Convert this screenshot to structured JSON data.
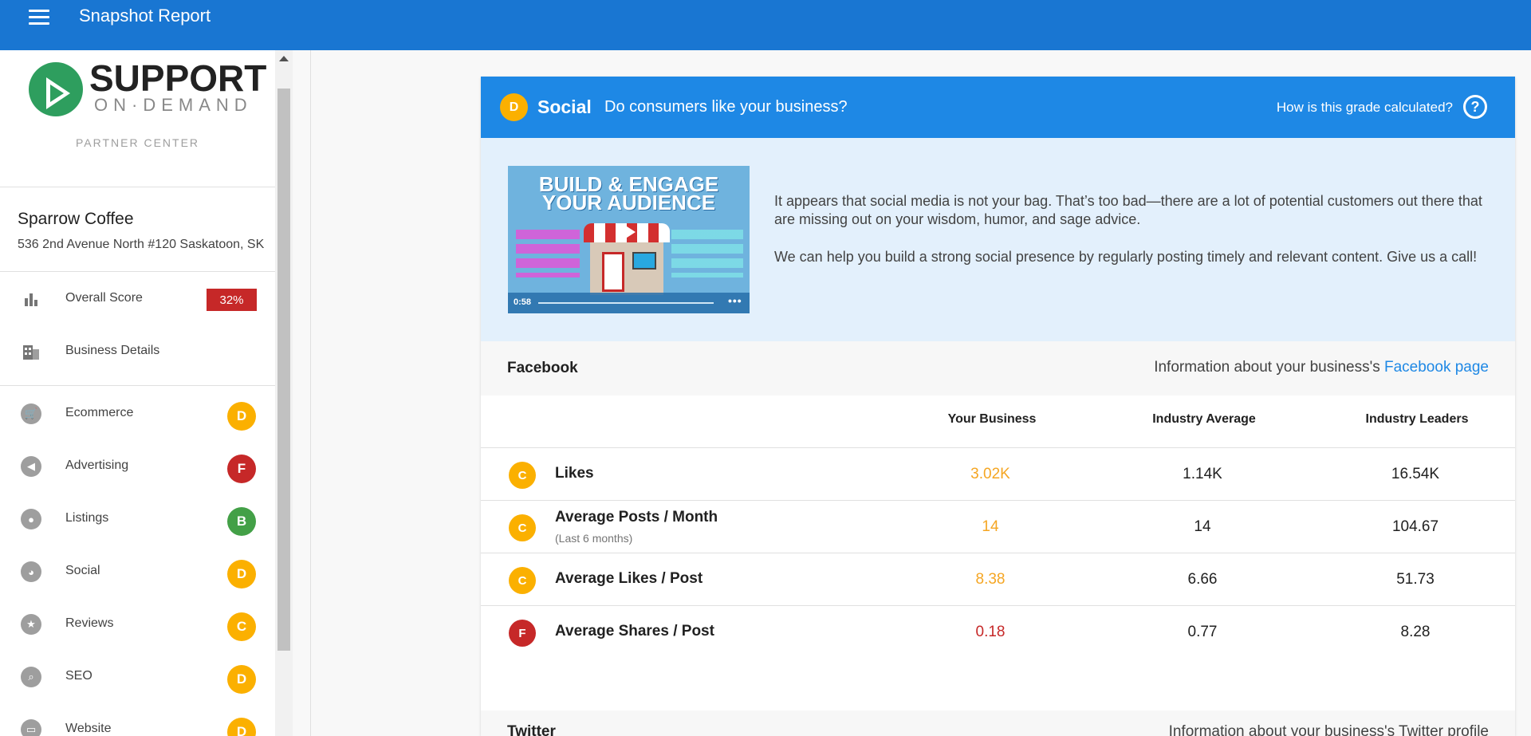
{
  "app": {
    "title": "Snapshot Report"
  },
  "brand": {
    "primary": "#1976d2",
    "panel_blue": "#1e88e5",
    "logo_green": "#2e9e5e"
  },
  "logo": {
    "line1": "SUPPORT",
    "line2": "ON·DEMAND",
    "tagline": "PARTNER CENTER"
  },
  "business": {
    "name": "Sparrow Coffee",
    "address": "536 2nd Avenue North #120 Saskatoon, SK"
  },
  "sidebar": {
    "overall": {
      "label": "Overall Score",
      "score": "32%",
      "icon": "bar-chart-icon"
    },
    "details": {
      "label": "Business Details",
      "icon": "building-icon"
    },
    "items": [
      {
        "label": "Ecommerce",
        "grade": "D",
        "icon": "cart-icon"
      },
      {
        "label": "Advertising",
        "grade": "F",
        "icon": "megaphone-icon"
      },
      {
        "label": "Listings",
        "grade": "B",
        "icon": "pin-icon"
      },
      {
        "label": "Social",
        "grade": "D",
        "icon": "chat-icon"
      },
      {
        "label": "Reviews",
        "grade": "C",
        "icon": "star-icon"
      },
      {
        "label": "SEO",
        "grade": "D",
        "icon": "search-icon"
      },
      {
        "label": "Website",
        "grade": "D",
        "icon": "monitor-icon"
      }
    ]
  },
  "social": {
    "grade": "D",
    "title": "Social",
    "subtitle": "Do consumers like your business?",
    "how_label": "How is this grade calculated?",
    "help_glyph": "?",
    "video": {
      "title_line1": "BUILD & ENGAGE",
      "title_line2": "YOUR AUDIENCE",
      "time": "0:58",
      "more": "•••"
    },
    "paragraph1": " It appears that social media is not your bag. That’s too bad—there are a lot of potential customers out there that are missing out on your wisdom, humor, and sage advice.",
    "paragraph2": "We can help you build a strong social presence by regularly posting timely and relevant content. Give us a call!"
  },
  "facebook": {
    "title": "Facebook",
    "info_prefix": "Information about your business's ",
    "info_link": "Facebook page",
    "columns": [
      "Your Business",
      "Industry Average",
      "Industry Leaders"
    ],
    "rows": [
      {
        "grade": "C",
        "label": "Likes",
        "sub": "",
        "yours": "3.02K",
        "avg": "1.14K",
        "leaders": "16.54K"
      },
      {
        "grade": "C",
        "label": "Average Posts / Month",
        "sub": "(Last 6 months)",
        "yours": "14",
        "avg": "14",
        "leaders": "104.67"
      },
      {
        "grade": "C",
        "label": "Average Likes / Post",
        "sub": "",
        "yours": "8.38",
        "avg": "6.66",
        "leaders": "51.73"
      },
      {
        "grade": "F",
        "label": "Average Shares / Post",
        "sub": "",
        "yours": "0.18",
        "avg": "0.77",
        "leaders": "8.28"
      }
    ]
  },
  "twitter": {
    "title": "Twitter",
    "info": "Information about your business's Twitter profile"
  }
}
